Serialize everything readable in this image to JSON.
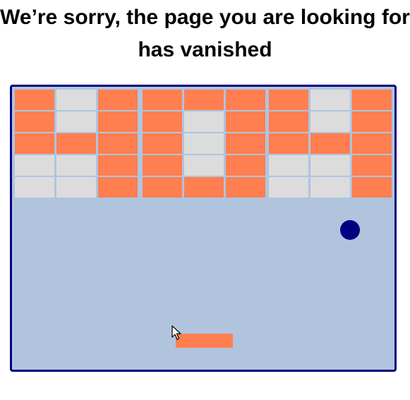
{
  "header": {
    "title": "We’re sorry, the page you are looking for has vanished"
  },
  "colors": {
    "background": "#ffffff",
    "playfield": "#b0c4de",
    "frame_border": "#000080",
    "brick_active": "#ff7f50",
    "brick_empty": "#dcdcdc",
    "ball": "#000080",
    "paddle": "#ff7f50"
  },
  "game": {
    "brick_grid": {
      "rows": 5,
      "columns": 9,
      "pattern": [
        [
          1,
          0,
          1,
          1,
          1,
          1,
          1,
          0,
          1
        ],
        [
          1,
          0,
          1,
          1,
          0,
          1,
          1,
          0,
          1
        ],
        [
          1,
          1,
          1,
          1,
          0,
          1,
          1,
          1,
          1
        ],
        [
          0,
          0,
          1,
          1,
          0,
          1,
          0,
          0,
          1
        ],
        [
          0,
          0,
          1,
          1,
          1,
          1,
          0,
          0,
          1
        ]
      ],
      "legend": {
        "1": "brick_active",
        "0": "brick_empty"
      }
    },
    "ball": {
      "icon": "ball-icon"
    },
    "paddle": {
      "icon": "paddle"
    }
  },
  "pointer": {
    "icon": "mouse-cursor-icon"
  }
}
